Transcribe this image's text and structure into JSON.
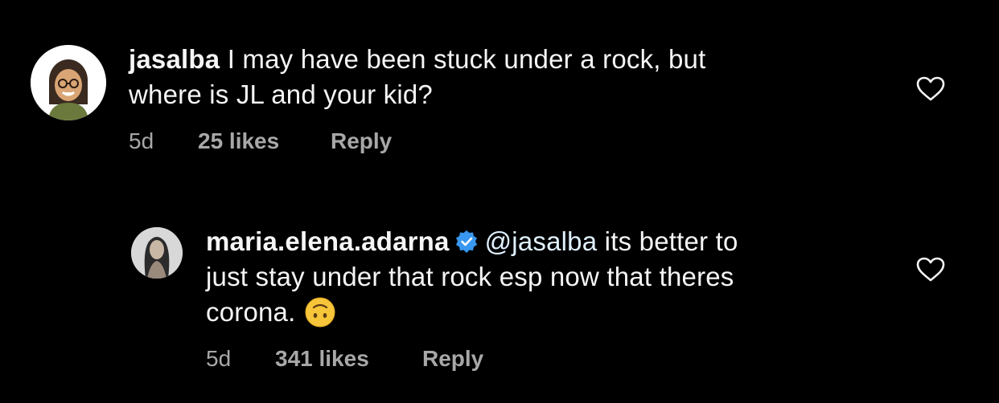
{
  "comments": [
    {
      "username": "jasalba",
      "text_line1": "I may have been stuck under a rock, but",
      "text_line2": "where is JL and your kid?",
      "time": "5d",
      "likes": "25 likes",
      "reply_label": "Reply",
      "avatar_icon": "bitmoji-avatar-icon",
      "like_icon": "heart-outline-icon"
    },
    {
      "username": "maria.elena.adarna",
      "verified_icon": "verified-badge-icon",
      "mention": "@jasalba",
      "text_line1": "its better to",
      "text_line2": "just stay under that rock esp now that theres",
      "text_line3": "corona.",
      "emoji": "upside-down-face-emoji",
      "time": "5d",
      "likes": "341 likes",
      "reply_label": "Reply",
      "avatar_icon": "profile-photo-avatar",
      "like_icon": "heart-outline-icon"
    }
  ],
  "colors": {
    "background": "#000000",
    "text": "#f5f5f5",
    "meta": "#a8a8a8",
    "verified": "#3897f0"
  }
}
